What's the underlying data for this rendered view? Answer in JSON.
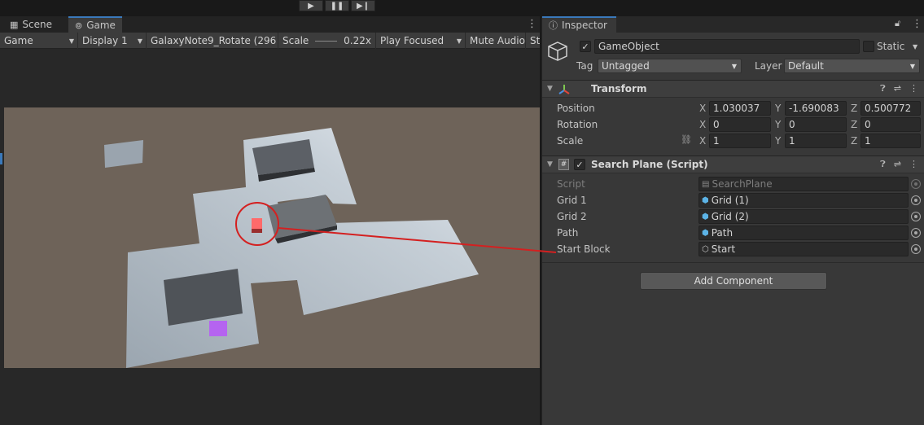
{
  "game_view": {
    "tabs": [
      {
        "label": "Scene",
        "icon": "scene-icon"
      },
      {
        "label": "Game",
        "icon": "gamepad-icon"
      }
    ],
    "toolbar": {
      "mode": "Game",
      "display": "Display 1",
      "resolution": "GalaxyNote9_Rotate (296",
      "scale_label": "Scale",
      "scale_value": "0.22x",
      "play_mode": "Play Focused",
      "mute_audio": "Mute Audio",
      "stats": "St"
    }
  },
  "inspector": {
    "tab_label": "Inspector",
    "object_name": "GameObject",
    "static_label": "Static",
    "tag_label": "Tag",
    "tag_value": "Untagged",
    "layer_label": "Layer",
    "layer_value": "Default",
    "transform": {
      "title": "Transform",
      "position_label": "Position",
      "rotation_label": "Rotation",
      "scale_label": "Scale",
      "position": {
        "x": "1.030037",
        "y": "-1.690083",
        "z": "0.500772"
      },
      "rotation": {
        "x": "0",
        "y": "0",
        "z": "0"
      },
      "scale": {
        "x": "1",
        "y": "1",
        "z": "1"
      },
      "axis_x": "X",
      "axis_y": "Y",
      "axis_z": "Z"
    },
    "script_component": {
      "title": "Search Plane (Script)",
      "script_label": "Script",
      "script_value": "SearchPlane",
      "fields": [
        {
          "label": "Grid 1",
          "value": "Grid (1)",
          "icon": "prefab-cube-icon"
        },
        {
          "label": "Grid 2",
          "value": "Grid (2)",
          "icon": "prefab-cube-icon"
        },
        {
          "label": "Path",
          "value": "Path",
          "icon": "prefab-cube-icon"
        },
        {
          "label": "Start Block",
          "value": "Start",
          "icon": "gameobject-cube-icon"
        }
      ]
    },
    "add_component": "Add Component"
  },
  "colors": {
    "accent_blue": "#3a79bb",
    "annotation_red": "#d42020",
    "viewport_bg": "#6e6359",
    "selected_cube": "#ff6a6a",
    "purple_cube": "#b564f0"
  }
}
